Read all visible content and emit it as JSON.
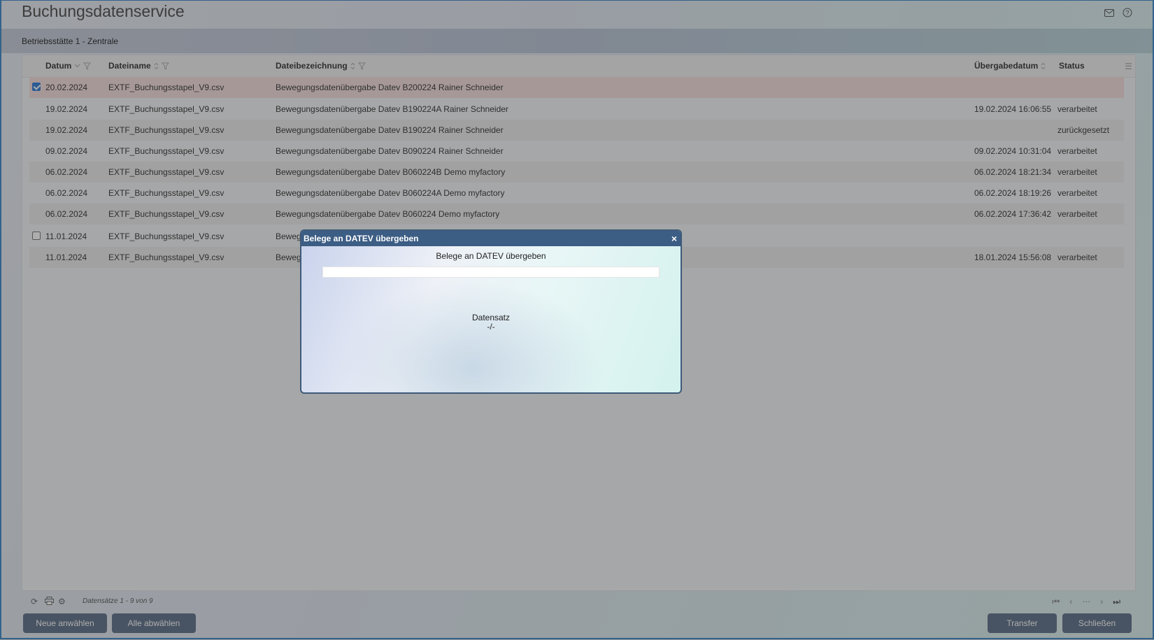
{
  "app": {
    "title": "Buchungsdatenservice",
    "mail_icon": "mail-icon",
    "help_icon": "help-icon"
  },
  "subheader": {
    "label": "Betriebsstätte 1 - Zentrale"
  },
  "grid": {
    "columns": [
      {
        "label": "Datum",
        "sort_icon": "chevron-down-icon",
        "filter_icon": "filter-icon"
      },
      {
        "label": "Dateiname",
        "sort_icon": "sort-icon",
        "filter_icon": "filter-icon"
      },
      {
        "label": "Dateibezeichnung",
        "sort_icon": "sort-icon",
        "filter_icon": "filter-icon"
      },
      {
        "label": "Übergabedatum",
        "sort_icon": "sort-icon"
      },
      {
        "label": "Status"
      }
    ],
    "rows": [
      {
        "checkbox": true,
        "checked": true,
        "datum": "20.02.2024",
        "dateiname": "EXTF_Buchungsstapel_V9.csv",
        "bezeichnung": "Bewegungsdatenübergabe Datev B200224 Rainer Schneider",
        "uebergabe": "",
        "status": ""
      },
      {
        "checkbox": false,
        "checked": false,
        "datum": "19.02.2024",
        "dateiname": "EXTF_Buchungsstapel_V9.csv",
        "bezeichnung": "Bewegungsdatenübergabe Datev B190224A Rainer Schneider",
        "uebergabe": "19.02.2024 16:06:55",
        "status": "verarbeitet"
      },
      {
        "checkbox": false,
        "checked": false,
        "datum": "19.02.2024",
        "dateiname": "EXTF_Buchungsstapel_V9.csv",
        "bezeichnung": "Bewegungsdatenübergabe Datev B190224 Rainer Schneider",
        "uebergabe": "",
        "status": "zurückgesetzt"
      },
      {
        "checkbox": false,
        "checked": false,
        "datum": "09.02.2024",
        "dateiname": "EXTF_Buchungsstapel_V9.csv",
        "bezeichnung": "Bewegungsdatenübergabe Datev B090224 Rainer Schneider",
        "uebergabe": "09.02.2024 10:31:04",
        "status": "verarbeitet"
      },
      {
        "checkbox": false,
        "checked": false,
        "datum": "06.02.2024",
        "dateiname": "EXTF_Buchungsstapel_V9.csv",
        "bezeichnung": "Bewegungsdatenübergabe Datev B060224B Demo myfactory",
        "uebergabe": "06.02.2024 18:21:34",
        "status": "verarbeitet"
      },
      {
        "checkbox": false,
        "checked": false,
        "datum": "06.02.2024",
        "dateiname": "EXTF_Buchungsstapel_V9.csv",
        "bezeichnung": "Bewegungsdatenübergabe Datev B060224A Demo myfactory",
        "uebergabe": "06.02.2024 18:19:26",
        "status": "verarbeitet"
      },
      {
        "checkbox": false,
        "checked": false,
        "datum": "06.02.2024",
        "dateiname": "EXTF_Buchungsstapel_V9.csv",
        "bezeichnung": "Bewegungsdatenübergabe Datev B060224 Demo myfactory",
        "uebergabe": "06.02.2024 17:36:42",
        "status": "verarbeitet"
      },
      {
        "checkbox": true,
        "checked": false,
        "datum": "11.01.2024",
        "dateiname": "EXTF_Buchungsstapel_V9.csv",
        "bezeichnung": "Beweg",
        "uebergabe": "",
        "status": ""
      },
      {
        "checkbox": false,
        "checked": false,
        "datum": "11.01.2024",
        "dateiname": "EXTF_Buchungsstapel_V9.csv",
        "bezeichnung": "Beweg",
        "uebergabe": "18.01.2024 15:56:08",
        "status": "verarbeitet"
      }
    ]
  },
  "footer": {
    "record_count": "Datensätze 1 - 9 von 9",
    "icons": [
      "refresh-icon",
      "print-icon",
      "settings-icon"
    ],
    "pager_icons": [
      "first-page-icon",
      "prev-page-icon",
      "more-icon",
      "next-page-icon",
      "last-page-icon"
    ]
  },
  "buttons": {
    "neue_anwaehlen": "Neue anwählen",
    "alle_abwaehlen": "Alle abwählen",
    "transfer": "Transfer",
    "schliessen": "Schließen"
  },
  "dialog": {
    "title": "Belege an DATEV übergeben",
    "close_glyph": "×",
    "subtitle": "Belege an DATEV übergeben",
    "progress": 0,
    "record_label": "Datensatz",
    "record_value": "-/-"
  }
}
